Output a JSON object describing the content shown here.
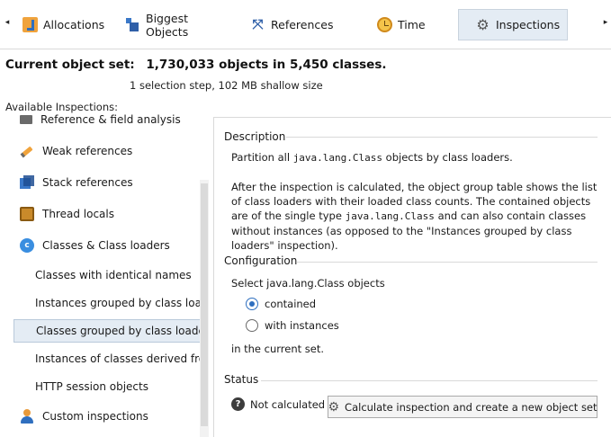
{
  "tabs": [
    {
      "label": "Allocations",
      "icon": "allocations-icon"
    },
    {
      "label": "Biggest Objects",
      "icon": "biggest-objects-icon"
    },
    {
      "label": "References",
      "icon": "references-icon"
    },
    {
      "label": "Time",
      "icon": "time-icon"
    },
    {
      "label": "Inspections",
      "icon": "gear-icon",
      "active": true
    }
  ],
  "scroll": {
    "left": "◂",
    "right": "▸"
  },
  "header": {
    "current_set_label": "Current object set:",
    "current_set_value": "1,730,033 objects in 5,450 classes.",
    "subline": "1 selection step, 102 MB shallow size",
    "available_label": "Available Inspections:"
  },
  "inspections": [
    {
      "label": "Reference & field analysis",
      "icon": "analysis-icon"
    },
    {
      "label": "Weak references",
      "icon": "pencil-icon"
    },
    {
      "label": "Stack references",
      "icon": "stack-icon"
    },
    {
      "label": "Thread locals",
      "icon": "thread-icon"
    },
    {
      "label": "Classes & Class loaders",
      "icon": "class-icon",
      "icon_text": "c"
    },
    {
      "label": "Classes with identical names",
      "sub": true
    },
    {
      "label": "Instances grouped by class loaders",
      "sub": true
    },
    {
      "label": "Classes grouped by class loaders",
      "sub": true,
      "selected": true
    },
    {
      "label": "Instances of classes derived from spe",
      "sub": true
    },
    {
      "label": "HTTP session objects",
      "sub": true
    },
    {
      "label": "Custom inspections",
      "icon": "user-icon"
    }
  ],
  "description": {
    "title": "Description",
    "p1_before": "Partition all ",
    "p1_code": "java.lang.Class",
    "p1_after": " objects by class loaders.",
    "p2_a": "After the inspection is calculated, the object group table shows the list of class loaders with their loaded class counts. The contained objects are of the single type ",
    "p2_code": "java.lang.Class",
    "p2_b": " and can also contain classes without instances (as opposed to the \"Instances grouped by class loaders\" inspection)."
  },
  "configuration": {
    "title": "Configuration",
    "select_label": "Select java.lang.Class objects",
    "options": [
      {
        "label": "contained",
        "checked": true
      },
      {
        "label": "with instances",
        "checked": false
      }
    ],
    "suffix": "in the current set."
  },
  "status": {
    "title": "Status",
    "q_glyph": "?",
    "value": "Not calculated",
    "button_label": "Calculate inspection and create a new object set",
    "button_glyph": "⚙"
  },
  "glyphs": {
    "references": "⤧",
    "gear": "⚙"
  }
}
